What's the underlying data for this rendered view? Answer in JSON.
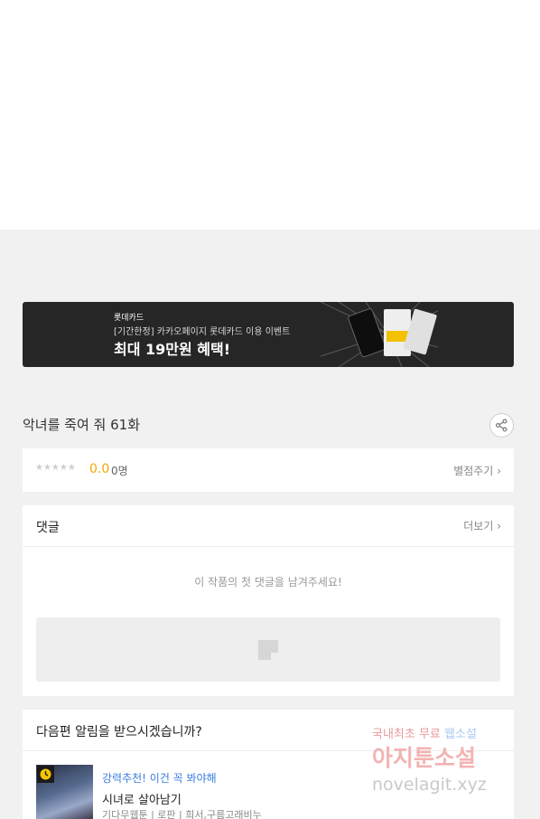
{
  "banner": {
    "brand": "롯데카드",
    "subtitle": "[기간한정] 카카오페이지 롯데카드 이용 이벤트",
    "headline": "최대 19만원 혜택!"
  },
  "episode": {
    "title": "악녀를 죽여 줘 61화"
  },
  "rating": {
    "stars": "★★★★★",
    "score": "0.0",
    "count": "0명",
    "rate_link": "별점주기"
  },
  "comments": {
    "header": "댓글",
    "more_link": "더보기",
    "empty_message": "이 작품의 첫 댓글을 남겨주세요!"
  },
  "notify": {
    "question": "다음편 알림을 받으시겠습니까?",
    "recommend_label": "강력추천! 이건 꼭 봐야해",
    "title": "시녀로 살아남기",
    "meta": "기다무웹툰 | 로판 | 희서,구름고래비누"
  },
  "watermark": {
    "line1_pre": "국내최초 무료",
    "line1_accent": "웹소설",
    "line2": "아지툰소설",
    "line3": "novelagit.xyz"
  },
  "colors": {
    "accent_score": "#f0a800",
    "recommend": "#3a7be0",
    "banner_bg": "#262626"
  }
}
